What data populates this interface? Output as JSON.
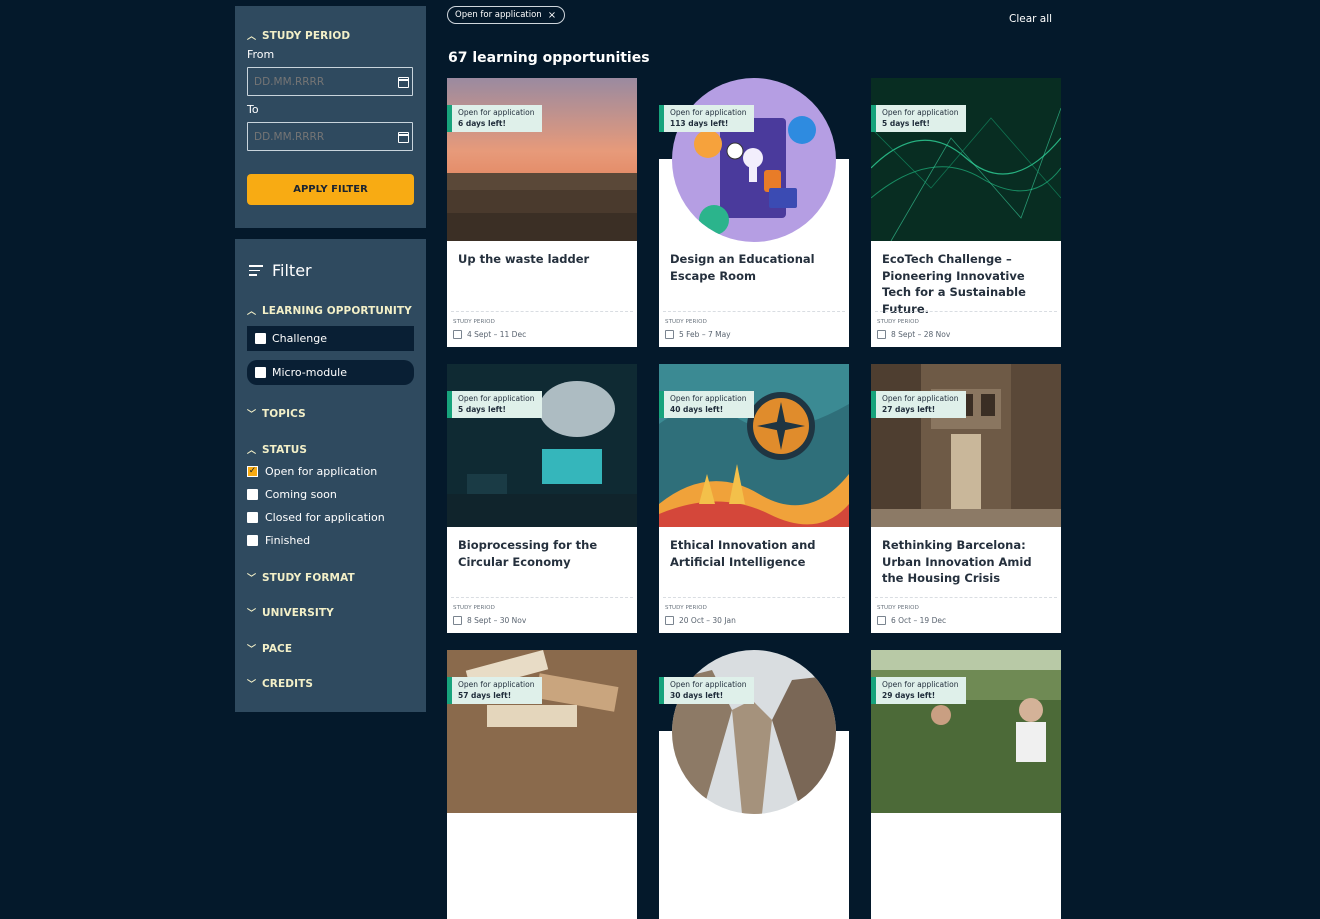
{
  "sidebar": {
    "study_period": {
      "title": "STUDY PERIOD",
      "from_label": "From",
      "from_placeholder": "DD.MM.RRRR",
      "to_label": "To",
      "to_placeholder": "DD.MM.RRRR",
      "apply_label": "APPLY FILTER"
    },
    "filter_title": "Filter",
    "learning_opportunity": {
      "title": "LEARNING OPPORTUNITY",
      "options": [
        "Challenge",
        "Micro-module"
      ]
    },
    "topics": "TOPICS",
    "status": {
      "title": "STATUS",
      "options": [
        {
          "label": "Open for application",
          "checked": true
        },
        {
          "label": "Coming soon",
          "checked": false
        },
        {
          "label": "Closed for application",
          "checked": false
        },
        {
          "label": "Finished",
          "checked": false
        }
      ]
    },
    "study_format": "STUDY FORMAT",
    "university": "UNIVERSITY",
    "pace": "PACE",
    "credits": "CREDITS"
  },
  "active_filter": {
    "label": "Open for application",
    "remove": "×"
  },
  "clear_all": "Clear all",
  "results_count": "67 learning opportunities",
  "cards": [
    {
      "title": "Up the waste ladder",
      "status": "Open for application",
      "days": "6 days left!",
      "period_label": "STUDY PERIOD",
      "period": "4 Sept – 11 Dec"
    },
    {
      "title": "Design an Educational Escape Room",
      "status": "Open for application",
      "days": "113 days left!",
      "period_label": "STUDY PERIOD",
      "period": "5 Feb – 7 May"
    },
    {
      "title": "EcoTech Challenge – Pioneering Innovative Tech for a Sustainable Future.",
      "status": "Open for application",
      "days": "5 days left!",
      "period_label": "STUDY PERIOD",
      "period": "8 Sept – 28 Nov"
    },
    {
      "title": "Bioprocessing for the Circular Economy",
      "status": "Open for application",
      "days": "5 days left!",
      "period_label": "STUDY PERIOD",
      "period": "8 Sept – 30 Nov"
    },
    {
      "title": "Ethical Innovation and Artificial Intelligence",
      "status": "Open for application",
      "days": "40 days left!",
      "period_label": "STUDY PERIOD",
      "period": "20 Oct – 30 Jan"
    },
    {
      "title": "Rethinking Barcelona: Urban Innovation Amid the Housing Crisis",
      "status": "Open for application",
      "days": "27 days left!",
      "period_label": "STUDY PERIOD",
      "period": "6 Oct – 19 Dec"
    },
    {
      "title": "",
      "status": "Open for application",
      "days": "57 days left!",
      "period_label": "",
      "period": ""
    },
    {
      "title": "",
      "status": "Open for application",
      "days": "30 days left!",
      "period_label": "",
      "period": ""
    },
    {
      "title": "",
      "status": "Open for application",
      "days": "29 days left!",
      "period_label": "",
      "period": ""
    }
  ],
  "colors": {
    "page_bg": "#04192b",
    "panel_bg": "#2f4a5f",
    "accent": "#f8ab13",
    "badge_bg": "#dff0ea",
    "badge_border": "#17a37c"
  }
}
